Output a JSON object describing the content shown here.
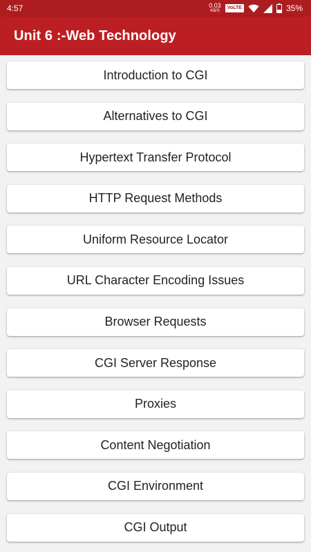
{
  "status_bar": {
    "time": "4:57",
    "net_speed_value": "0.03",
    "net_speed_unit": "KB/S",
    "volte_label": "VoLTE",
    "battery_percent": "35%",
    "icons": [
      "wifi-icon",
      "signal-icon",
      "battery-icon"
    ]
  },
  "app_bar": {
    "title": "Unit 6 :-Web Technology",
    "color": "#bc1f23"
  },
  "menu": {
    "items": [
      {
        "label": "Introduction to CGI"
      },
      {
        "label": "Alternatives to CGI"
      },
      {
        "label": "Hypertext Transfer Protocol"
      },
      {
        "label": "HTTP Request Methods"
      },
      {
        "label": "Uniform Resource Locator"
      },
      {
        "label": "URL Character Encoding Issues"
      },
      {
        "label": "Browser Requests"
      },
      {
        "label": "CGI Server Response"
      },
      {
        "label": "Proxies"
      },
      {
        "label": "Content Negotiation"
      },
      {
        "label": "CGI Environment"
      },
      {
        "label": "CGI Output"
      }
    ]
  }
}
